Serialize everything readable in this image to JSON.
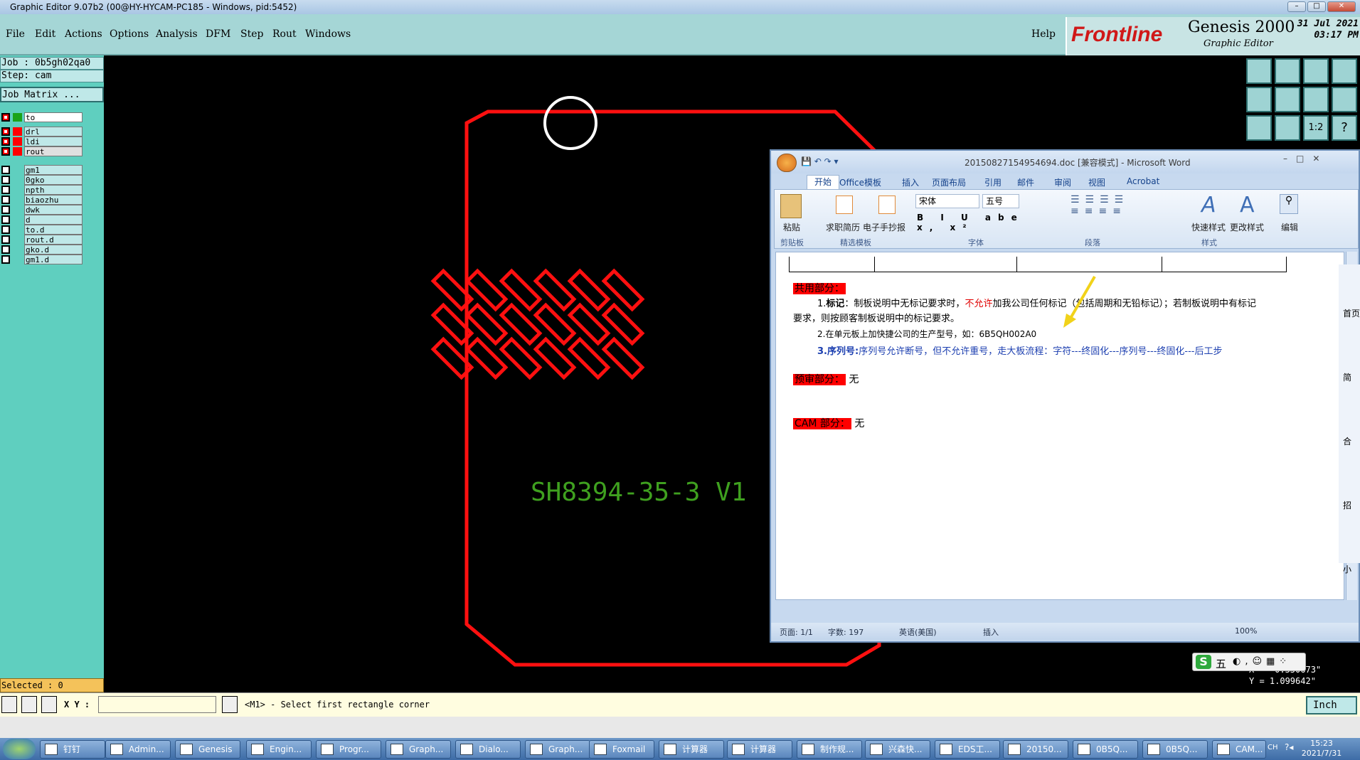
{
  "window": {
    "title": "Graphic Editor 9.07b2 (00@HY-HYCAM-PC185 - Windows, pid:5452)"
  },
  "menu": {
    "items": [
      "File",
      "Edit",
      "Actions",
      "Options",
      "Analysis",
      "DFM",
      "Step",
      "Rout",
      "Windows"
    ],
    "help": "Help"
  },
  "brand": {
    "logo": "Frontline",
    "product": "Genesis 2000",
    "subtitle": "Graphic Editor",
    "date": "31 Jul 2021",
    "time": "03:17 PM"
  },
  "job": {
    "job_line": "Job : 0b5gh02qa0",
    "step_line": "Step: cam",
    "matrix": "Job Matrix ..."
  },
  "layers": [
    {
      "name": "to",
      "box": "#ffffff",
      "color": "#1aa31a"
    },
    {
      "name": "drl",
      "box": "#ffffff",
      "color": "#ff0000"
    },
    {
      "name": "ldi",
      "box": "#ffffff",
      "color": "#ff0000"
    },
    {
      "name": "rout",
      "box": "#ffffff",
      "color": "#ff0000"
    },
    {
      "name": "gm1",
      "box": "#ffffff",
      "color": ""
    },
    {
      "name": "0gko",
      "box": "#ffffff",
      "color": ""
    },
    {
      "name": "npth",
      "box": "#ffffff",
      "color": ""
    },
    {
      "name": "biaozhu",
      "box": "#ffffff",
      "color": ""
    },
    {
      "name": "dwk",
      "box": "#ffffff",
      "color": ""
    },
    {
      "name": "d",
      "box": "#ffffff",
      "color": ""
    },
    {
      "name": "to.d",
      "box": "#ffffff",
      "color": ""
    },
    {
      "name": "rout.d",
      "box": "#ffffff",
      "color": ""
    },
    {
      "name": "gko.d",
      "box": "#ffffff",
      "color": ""
    },
    {
      "name": "gm1.d",
      "box": "#ffffff",
      "color": ""
    }
  ],
  "canvas": {
    "board_text": "SH8394-35-3   V1",
    "outline_color": "#ff1010",
    "text_color": "#3fa01f"
  },
  "selected": "Selected : 0",
  "command": {
    "xy_label": "X Y :",
    "prompt": "<M1> - Select first rectangle corner",
    "unit": "Inch"
  },
  "coords": {
    "x": "X = -0.550673\"",
    "y": "Y = 1.099642\""
  },
  "word": {
    "title": "20150827154954694.doc [兼容模式] - Microsoft Word",
    "tabs": [
      "开始",
      "Office模板",
      "插入",
      "页面布局",
      "引用",
      "邮件",
      "审阅",
      "视图",
      "Acrobat"
    ],
    "groups": [
      "剪贴板",
      "精选模板",
      "字体",
      "段落",
      "样式"
    ],
    "ribbon_buttons": {
      "paste": "粘贴",
      "resume": "求职简历",
      "ecard": "电子手抄报",
      "quick_style": "快速样式",
      "change_style": "更改样式",
      "edit": "编辑"
    },
    "font_name": "宋体",
    "font_size": "五号",
    "doc": {
      "h1": "共用部分：",
      "p1_num": "1.",
      "p1_bold": "标记",
      "p1_a": "：制板说明中无标记要求时，",
      "p1_red": "不允许",
      "p1_b": "加我公司任何标记（包括周期和无铅标记）；若制板说明中有标记",
      "p1_c": "要求，则按顾客制板说明中的标记要求。",
      "p2": "2.在单元板上加快捷公司的生产型号，如：6B5QH002A0",
      "p3_bold": "3.序列号:",
      "p3_text": "序列号允许断号，但不允许重号，走大板流程：字符---终固化---序列号---终固化---后工步",
      "h2": "预审部分：",
      "h2_val": "无",
      "h3": "CAM 部分：",
      "h3_val": "无"
    },
    "status": {
      "page": "页面: 1/1",
      "words": "字数: 197",
      "lang": "英语(美国)",
      "mode": "插入",
      "zoom": "100%"
    },
    "side_labels": [
      "首页",
      "简",
      "合",
      "招",
      "小"
    ]
  },
  "ime": {
    "label": "五"
  },
  "taskbar": {
    "items": [
      "钉钉",
      "Admin...",
      "Genesis",
      "Engin...",
      "Progr...",
      "Graph...",
      "Dialo...",
      "Graph...",
      "Foxmail",
      "计算器",
      "计算器",
      "制作规...",
      "兴森快...",
      "EDS工...",
      "20150...",
      "0B5Q...",
      "0B5Q...",
      "CAM..."
    ],
    "tray_lang": "CH",
    "clock_time": "15:23",
    "clock_date": "2021/7/31"
  }
}
